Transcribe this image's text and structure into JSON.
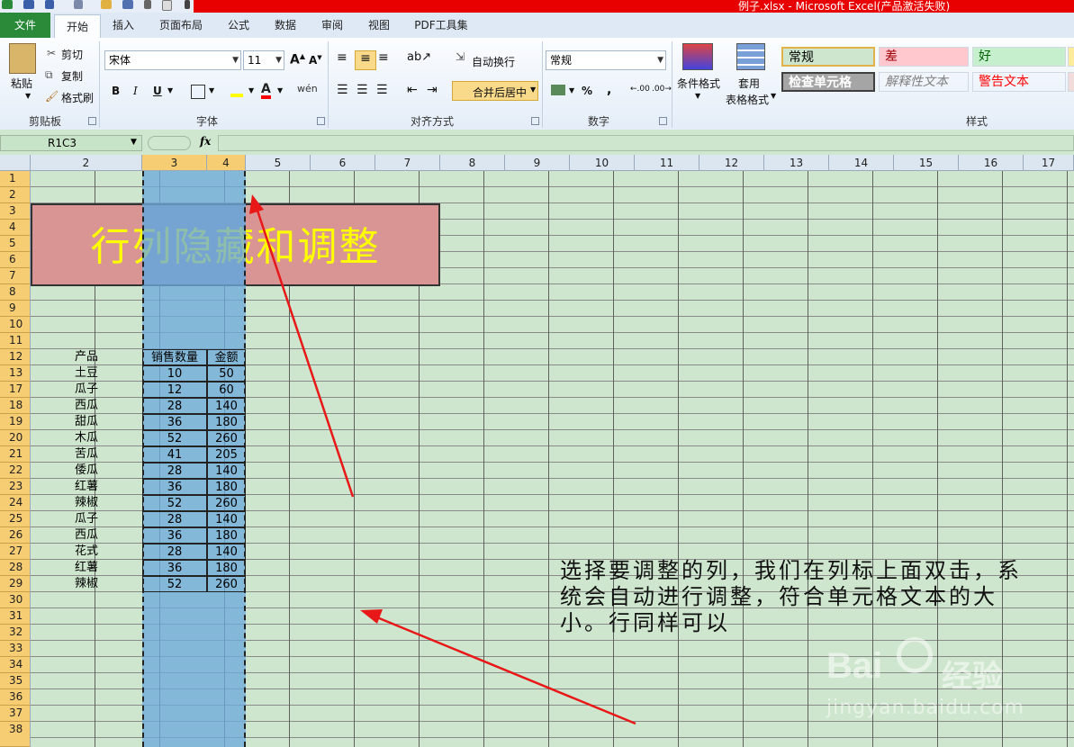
{
  "title_bar": {
    "title": "例子.xlsx - Microsoft Excel(产品激活失败)"
  },
  "tabs": [
    {
      "label": "文件"
    },
    {
      "label": "开始"
    },
    {
      "label": "插入"
    },
    {
      "label": "页面布局"
    },
    {
      "label": "公式"
    },
    {
      "label": "数据"
    },
    {
      "label": "审阅"
    },
    {
      "label": "视图"
    },
    {
      "label": "PDF工具集"
    }
  ],
  "ribbon": {
    "clipboard": {
      "paste": "粘贴",
      "cut": "剪切",
      "copy": "复制",
      "format_painter": "格式刷",
      "label": "剪贴板"
    },
    "font": {
      "name": "宋体",
      "size": "11",
      "bold": "B",
      "italic": "I",
      "underline": "U",
      "phonetic": "wén",
      "label": "字体"
    },
    "alignment": {
      "wrap": "自动换行",
      "merge": "合并后居中",
      "label": "对齐方式"
    },
    "number": {
      "format": "常规",
      "percent": "%",
      "comma": ",",
      "label": "数字"
    },
    "styles_group": {
      "conditional": "条件格式",
      "table_line1": "套用",
      "table_line2": "表格格式",
      "label": "样式",
      "cells": [
        {
          "text": "常规",
          "color": "#000000",
          "bg": "#cde6cd"
        },
        {
          "text": "差",
          "color": "#9c0006",
          "bg": "#ffc7ce"
        },
        {
          "text": "好",
          "color": "#006100",
          "bg": "#c6efce"
        },
        {
          "text": "检查单元格",
          "color": "#ffffff",
          "bg": "#a5a5a5"
        },
        {
          "text": "解释性文本",
          "color": "#7f7f7f",
          "bg": "#cde6cd"
        },
        {
          "text": "警告文本",
          "color": "#ff0000",
          "bg": "#cde6cd"
        }
      ]
    }
  },
  "formula_bar": {
    "name_box": "R1C3",
    "fx": "fx",
    "value": ""
  },
  "columns": [
    "2",
    "3",
    "4",
    "5",
    "6",
    "7",
    "8",
    "9",
    "10",
    "11",
    "12",
    "13",
    "14",
    "15",
    "16",
    "17"
  ],
  "rows": [
    "1",
    "2",
    "3",
    "4",
    "5",
    "6",
    "7",
    "8",
    "9",
    "10",
    "11",
    "12",
    "13",
    "17",
    "18",
    "19",
    "20",
    "21",
    "22",
    "23",
    "24",
    "25",
    "26",
    "27",
    "28",
    "29",
    "30",
    "31",
    "32",
    "33",
    "34",
    "35",
    "36",
    "37",
    "38"
  ],
  "sheet_title": "行列隐藏和调整",
  "table": {
    "headers": [
      "产品",
      "销售数量",
      "金额"
    ],
    "rows": [
      [
        "土豆",
        "10",
        "50"
      ],
      [
        "瓜子",
        "12",
        "60"
      ],
      [
        "西瓜",
        "28",
        "140"
      ],
      [
        "甜瓜",
        "36",
        "180"
      ],
      [
        "木瓜",
        "52",
        "260"
      ],
      [
        "苦瓜",
        "41",
        "205"
      ],
      [
        "倭瓜",
        "28",
        "140"
      ],
      [
        "红薯",
        "36",
        "180"
      ],
      [
        "辣椒",
        "52",
        "260"
      ],
      [
        "瓜子",
        "28",
        "140"
      ],
      [
        "西瓜",
        "36",
        "180"
      ],
      [
        "花式",
        "28",
        "140"
      ],
      [
        "红薯",
        "36",
        "180"
      ],
      [
        "辣椒",
        "52",
        "260"
      ]
    ]
  },
  "note": {
    "line1": "选择要调整的列，我们在列标上面双击，系",
    "line2": "统会自动进行调整，符合单元格文本的大",
    "line3": "小。行同样可以"
  },
  "watermark": {
    "brand": "Bai",
    "brand2": "经验",
    "url": "jingyan.baidu.com"
  },
  "accent_color": "#e80000",
  "selection_color": "#6eaadc"
}
